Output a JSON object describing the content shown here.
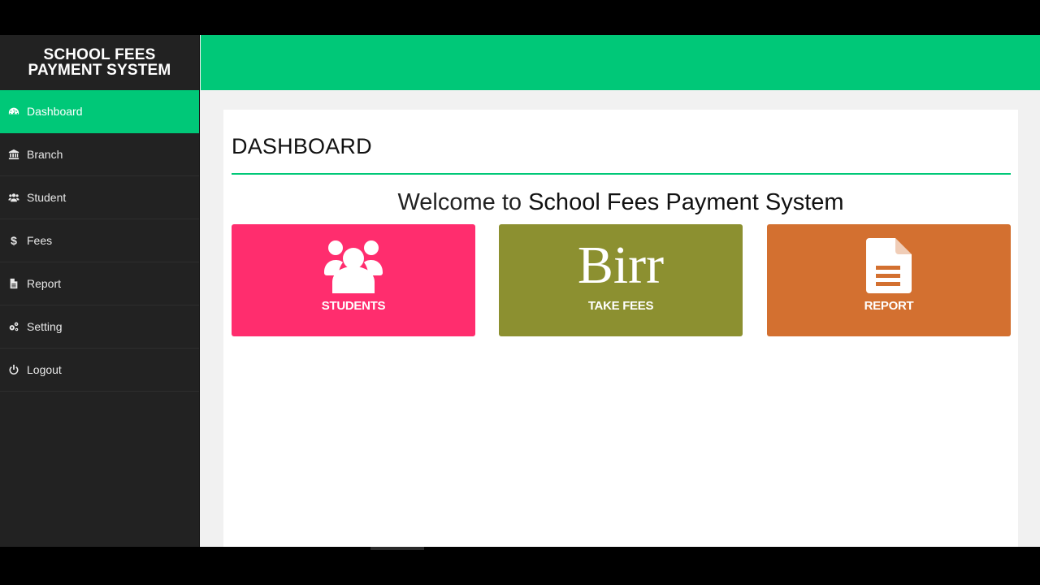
{
  "brand": {
    "line1": "SCHOOL FEES",
    "line2": "PAYMENT SYSTEM"
  },
  "sidebar": {
    "items": [
      {
        "label": "Dashboard",
        "icon": "dashboard-icon",
        "active": true
      },
      {
        "label": "Branch",
        "icon": "bank-icon"
      },
      {
        "label": "Student",
        "icon": "users-icon"
      },
      {
        "label": "Fees",
        "icon": "dollar-icon"
      },
      {
        "label": "Report",
        "icon": "document-icon"
      },
      {
        "label": "Setting",
        "icon": "gears-icon"
      },
      {
        "label": "Logout",
        "icon": "power-icon"
      }
    ]
  },
  "main": {
    "title": "DASHBOARD",
    "welcome_prefix": "Welcome to",
    "welcome_name": "School Fees Payment System",
    "tiles": [
      {
        "label": "STUDENTS",
        "icon": "users-icon",
        "color": "#ff2d6e"
      },
      {
        "label": "TAKE FEES",
        "icon_text": "Birr",
        "color": "#8c9030"
      },
      {
        "label": "REPORT",
        "icon": "document-icon",
        "color": "#d37030"
      }
    ]
  },
  "colors": {
    "accent": "#00c878",
    "sidebar_bg": "#222222"
  }
}
